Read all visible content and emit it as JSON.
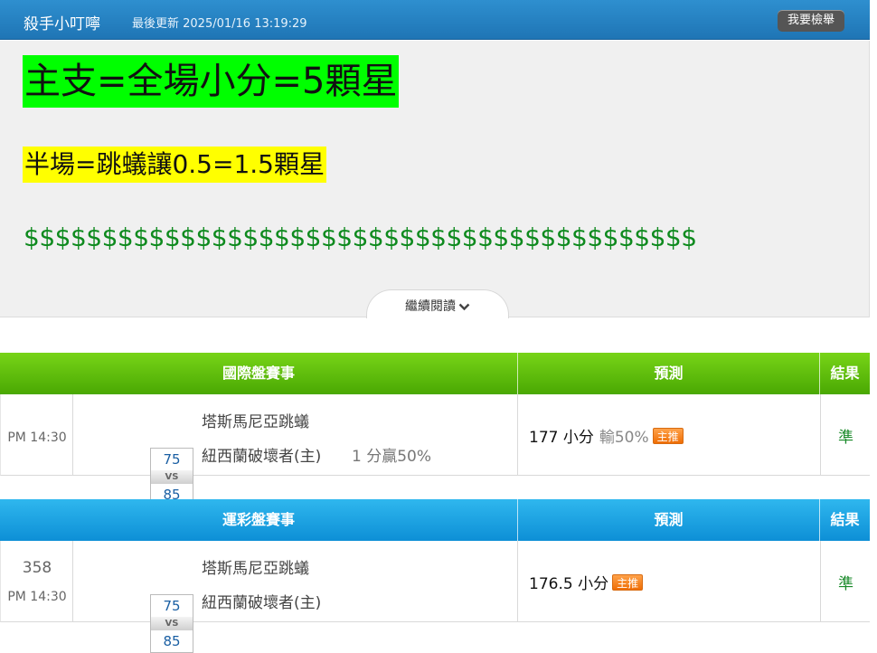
{
  "header": {
    "author": "殺手小叮嚀",
    "updated": "最後更新 2025/01/16 13:19:29",
    "report_button": "我要檢舉"
  },
  "article": {
    "line1": "主支=全場小分=5顆星",
    "line2": "半場=跳蟻讓0.5=1.5顆星",
    "line3": "$$$$$$$$$$$$$$$$$$$$$$$$$$$$$$$$$$$$$$$$$$$",
    "read_more": "繼續閱讀"
  },
  "sections": [
    {
      "title": "國際盤賽事",
      "col_prediction": "預測",
      "col_result": "結果",
      "match": {
        "number": "",
        "time": "PM 14:30",
        "away_score": "75",
        "vs": "VS",
        "home_score": "85",
        "away_team": "塔斯馬尼亞跳蟻",
        "home_team": "紐西蘭破壞者(主)",
        "handicap": "1 分贏50%",
        "prediction": "177 小分",
        "prediction_extra": "輸50%",
        "badge": "主推",
        "result": "準"
      }
    },
    {
      "title": "運彩盤賽事",
      "col_prediction": "預測",
      "col_result": "結果",
      "match": {
        "number": "358",
        "time": "PM 14:30",
        "away_score": "75",
        "vs": "VS",
        "home_score": "85",
        "away_team": "塔斯馬尼亞跳蟻",
        "home_team": "紐西蘭破壞者(主)",
        "handicap": "",
        "prediction": "176.5 小分",
        "prediction_extra": "",
        "badge": "主推",
        "result": "準"
      }
    }
  ],
  "colors": {
    "top_bar": "#1f75b5",
    "green_header": "#4aa803",
    "blue_header": "#0d8fd6",
    "highlight_green": "#00ff00",
    "highlight_yellow": "#ffff00",
    "dollar_text": "#0e8a1e",
    "result_text": "#1a8a2a"
  }
}
